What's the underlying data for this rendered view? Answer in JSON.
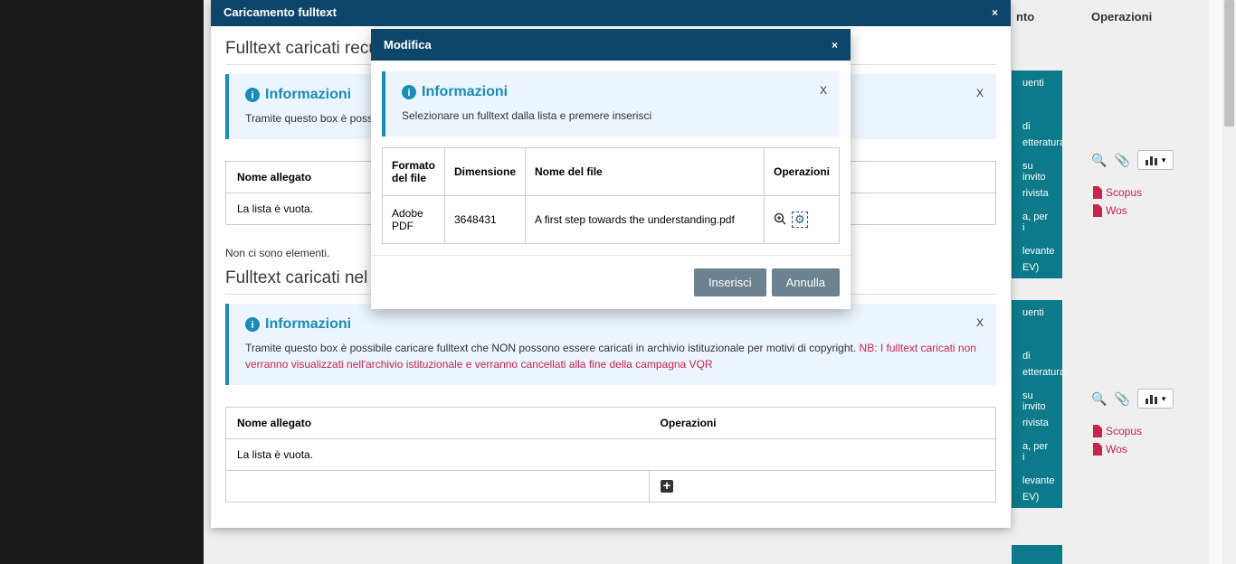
{
  "background": {
    "operazioni_header": "Operazioni",
    "uenti": "uenti",
    "card_lines": [
      "di",
      "etteratura",
      "",
      "su invito",
      "rivista",
      "",
      "a, per i",
      "",
      "levante",
      "EV)"
    ],
    "scopus": "Scopus",
    "wos": "Wos",
    "ento": "nto"
  },
  "modal1": {
    "title": "Caricamento fulltext",
    "section1_title": "Fulltext caricati recuperati dall'archivio istituzionale",
    "info1_title": "Informazioni",
    "info1_text": "Tramite questo box è possibile caricare fulltext",
    "info1_close": "X",
    "table1_h1": "Nome allegato",
    "table1_empty": "La lista è vuota.",
    "no_elements": "Non ci sono elementi.",
    "section2_title": "Fulltext caricati nel modulo VQR",
    "info2_title": "Informazioni",
    "info2_text": "Tramite questo box è possibile caricare fulltext che NON possono essere caricati in archivio istituzionale per motivi di copyright. ",
    "info2_red": "NB: I fulltext caricati non verranno visualizzati nell'archivio istituzionale e verranno cancellati alla fine della campagna VQR",
    "info2_close": "X",
    "table2_h1": "Nome allegato",
    "table2_h2": "Operazioni",
    "table2_empty": "La lista è vuota.",
    "plus": "+"
  },
  "modal2": {
    "title": "Modifica",
    "info_title": "Informazioni",
    "info_text": "Selezionare un fulltext dalla lista e premere inserisci",
    "info_close": "X",
    "th1": "Formato del file",
    "th2": "Dimensione",
    "th3": "Nome del file",
    "th4": "Operazioni",
    "td1": "Adobe PDF",
    "td2": "3648431",
    "td3": "A first step towards the understanding.pdf",
    "btn_insert": "Inserisci",
    "btn_cancel": "Annulla"
  }
}
